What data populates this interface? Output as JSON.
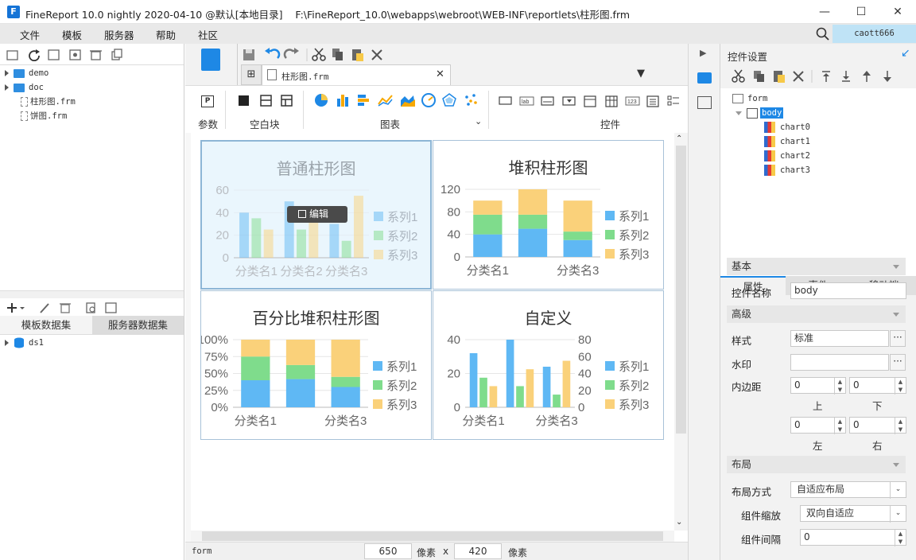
{
  "window": {
    "title": "FineReport 10.0 nightly 2020-04-10 @默认[本地目录]",
    "path": "F:\\FineReport_10.0\\webapps\\webroot\\WEB-INF\\reportlets\\柱形图.frm"
  },
  "menu": [
    "文件",
    "模板",
    "服务器",
    "帮助",
    "社区"
  ],
  "user": "caott666",
  "file_tree": [
    {
      "label": "demo",
      "type": "folder"
    },
    {
      "label": "doc",
      "type": "folder"
    },
    {
      "label": "柱形图.frm",
      "type": "file"
    },
    {
      "label": "饼图.frm",
      "type": "file"
    }
  ],
  "dataset_tabs": [
    "模板数据集",
    "服务器数据集"
  ],
  "datasets": [
    "ds1"
  ],
  "doc_tab": "柱形图.frm",
  "toolbar_groups": {
    "param": "参数",
    "blank": "空白块",
    "chart": "图表",
    "widget": "控件"
  },
  "colors": {
    "s1": "#5fb8f4",
    "s2": "#7fdc8c",
    "s3": "#fad17a",
    "accent": "#1e88e5"
  },
  "charts": [
    {
      "title": "普通柱形图",
      "edit_label": "编辑"
    },
    {
      "title": "堆积柱形图"
    },
    {
      "title": "百分比堆积柱形图"
    },
    {
      "title": "自定义"
    }
  ],
  "chart_data": [
    {
      "type": "bar",
      "title": "普通柱形图",
      "categories": [
        "分类名1",
        "分类名2",
        "分类名3"
      ],
      "series": [
        {
          "name": "系列1",
          "values": [
            40,
            50,
            30
          ]
        },
        {
          "name": "系列2",
          "values": [
            35,
            25,
            15
          ]
        },
        {
          "name": "系列3",
          "values": [
            25,
            45,
            55
          ]
        }
      ],
      "yticks": [
        "0",
        "20",
        "40",
        "60"
      ],
      "ylim": [
        0,
        60
      ],
      "legend": "right"
    },
    {
      "type": "bar",
      "stacked": true,
      "title": "堆积柱形图",
      "categories": [
        "分类名1",
        "分类名2",
        "分类名3"
      ],
      "series": [
        {
          "name": "系列1",
          "values": [
            40,
            50,
            30
          ]
        },
        {
          "name": "系列2",
          "values": [
            35,
            25,
            15
          ]
        },
        {
          "name": "系列3",
          "values": [
            25,
            45,
            55
          ]
        }
      ],
      "yticks": [
        "0",
        "40",
        "80",
        "120"
      ],
      "ylim": [
        0,
        120
      ],
      "xticklabels": [
        "分类名1",
        "分类名3"
      ],
      "legend": "right"
    },
    {
      "type": "bar",
      "stacked": true,
      "percent": true,
      "title": "百分比堆积柱形图",
      "categories": [
        "分类名1",
        "分类名2",
        "分类名3"
      ],
      "series": [
        {
          "name": "系列1",
          "values": [
            40,
            50,
            30
          ]
        },
        {
          "name": "系列2",
          "values": [
            35,
            25,
            15
          ]
        },
        {
          "name": "系列3",
          "values": [
            25,
            45,
            55
          ]
        }
      ],
      "yticks": [
        "0%",
        "25%",
        "50%",
        "75%",
        "100%"
      ],
      "ylim": [
        0,
        100
      ],
      "xticklabels": [
        "分类名1",
        "分类名3"
      ],
      "legend": "right"
    },
    {
      "type": "bar",
      "title": "自定义",
      "categories": [
        "分类名1",
        "分类名2",
        "分类名3"
      ],
      "series": [
        {
          "name": "系列1",
          "values": [
            40,
            50,
            30
          ],
          "axis": "left"
        },
        {
          "name": "系列2",
          "values": [
            35,
            25,
            15
          ],
          "axis": "right"
        },
        {
          "name": "系列3",
          "values": [
            25,
            45,
            55
          ],
          "axis": "right"
        }
      ],
      "yticks": [
        "0",
        "20",
        "40"
      ],
      "yticks_right": [
        "0",
        "20",
        "40",
        "60",
        "80"
      ],
      "ylim": [
        0,
        50
      ],
      "ylim_right": [
        0,
        80
      ],
      "xticklabels": [
        "分类名1",
        "分类名3"
      ],
      "legend": "right"
    }
  ],
  "status": {
    "name": "form",
    "width": "650",
    "unit": "像素",
    "x": "x",
    "height": "420",
    "unit2": "像素"
  },
  "right_panel": {
    "title": "控件设置",
    "tree": [
      {
        "label": "form"
      },
      {
        "label": "body"
      },
      {
        "label": "chart0"
      },
      {
        "label": "chart1"
      },
      {
        "label": "chart2"
      },
      {
        "label": "chart3"
      }
    ],
    "tabs": [
      "属性",
      "事件",
      "移动端"
    ],
    "sections": {
      "basic": "基本",
      "advanced": "高级",
      "layout": "布局"
    },
    "props": {
      "name_label": "控件名称",
      "name_value": "body",
      "style_label": "样式",
      "style_value": "标准",
      "watermark_label": "水印",
      "watermark_value": "",
      "padding_label": "内边距",
      "pad_top": "0",
      "pad_bottom": "0",
      "pad_left": "0",
      "pad_right": "0",
      "top": "上",
      "bottom": "下",
      "left": "左",
      "right": "右",
      "layout_label": "布局方式",
      "layout_value": "自适应布局",
      "scale_label": "组件缩放",
      "scale_value": "双向自适应",
      "gap_label": "组件间隔",
      "gap_value": "0"
    }
  }
}
